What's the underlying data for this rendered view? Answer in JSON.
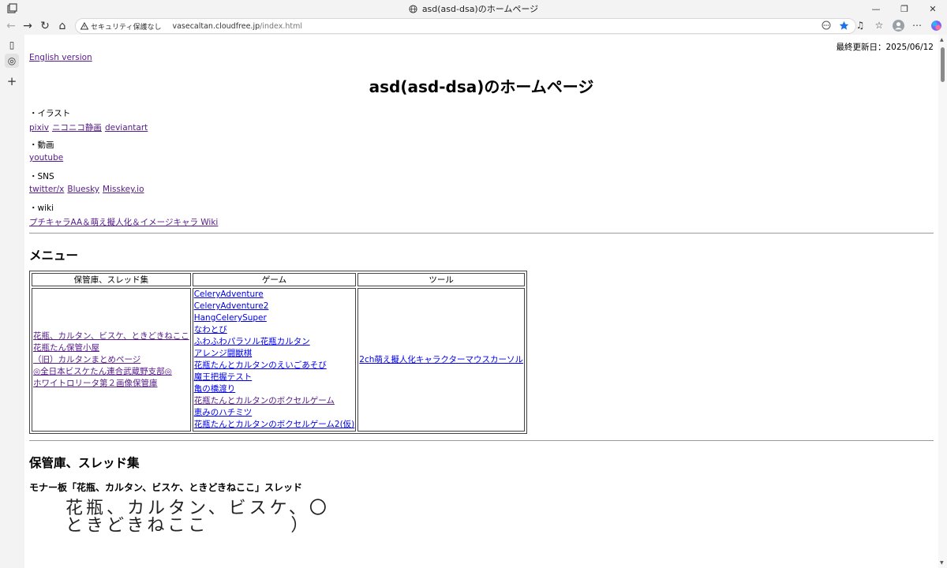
{
  "window": {
    "title": "asd(asd-dsa)のホームページ",
    "min": "—",
    "restore": "❐",
    "close": "✕"
  },
  "toolbar": {
    "back": "←",
    "forward": "→",
    "reload": "↻",
    "home": "⌂",
    "security_text": "セキュリティ保護なし",
    "url_host": "vasecaltan.cloudfree.jp",
    "url_path": "/index.html"
  },
  "page": {
    "last_updated": "最終更新日：2025/06/12",
    "english_link": "English version",
    "title": "asd(asd-dsa)のホームページ",
    "sections": [
      {
        "label": "・イラスト",
        "links": [
          "pixiv",
          "ニコニコ静画",
          "deviantart"
        ]
      },
      {
        "label": "・動画",
        "links": [
          "youtube"
        ]
      },
      {
        "label": "・SNS",
        "links": [
          "twitter/x",
          "Bluesky",
          "Misskey.io"
        ]
      },
      {
        "label": "・wiki",
        "links": [
          "プチキャラAA＆萌え擬人化＆イメージキャラ Wiki"
        ]
      }
    ],
    "menu_heading": "メニュー",
    "menu_table": {
      "headers": [
        "保管庫、スレッド集",
        "ゲーム",
        "ツール"
      ],
      "col1": [
        "花瓶、カルタン、ビスケ、ときどきねここ",
        "花瓶たん保管小屋",
        "（旧）カルタンまとめページ",
        "◎全日本ビスケたん連合武蔵野支部◎",
        "ホワイトロリータ第２画像保管庫"
      ],
      "col2": [
        "CeleryAdventure",
        "CeleryAdventure2",
        "HangCelerySuper",
        "なわとび",
        "ふわふわパラソル花瓶カルタン",
        "アレンジ闘獣棋",
        "花瓶たんとカルタンのえいごあそび",
        "魔王把握テスト",
        "亀の橋渡り",
        "花瓶たんとカルタンのボクセルゲーム",
        "恵みのハチミツ",
        "花瓶たんとカルタンのボクセルゲーム2(仮)"
      ],
      "col3": [
        "2ch萌え擬人化キャラクターマウスカーソル"
      ]
    },
    "archive_heading": "保管庫、スレッド集",
    "thread_heading": "モナー板「花瓶、カルタン、ビスケ、ときどきねここ」スレッド",
    "banner_line1": "花瓶、カルタン、ビスケ、〇",
    "banner_line2": "ときどきねここ　　　　）"
  }
}
